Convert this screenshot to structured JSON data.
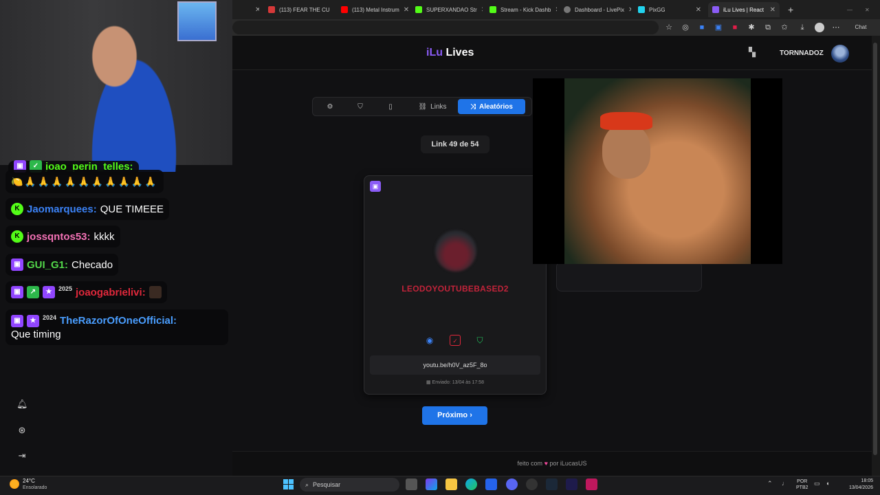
{
  "browser": {
    "tabs": [
      {
        "label": "(113) FEAR THE CU",
        "color": "#d63939"
      },
      {
        "label": "(113) Metal Instrum",
        "color": "#ff0000"
      },
      {
        "label": "SUPERXANDAO Str",
        "color": "#53fc18"
      },
      {
        "label": "Stream - Kick Dashb",
        "color": "#53fc18"
      },
      {
        "label": "Dashboard - LivePix",
        "color": "#777777"
      },
      {
        "label": "PixGG",
        "color": "#22d3ee"
      },
      {
        "label": "iLu Lives | React",
        "color": "#8b5cf6"
      }
    ],
    "new_tab_symbol": "+",
    "close_symbol": "✕",
    "chat_label": "Chat"
  },
  "app": {
    "logo_prefix": "iLu",
    "logo_suffix": "Lives",
    "username": "TORNNADOZ"
  },
  "toolbar": {
    "links_label": "Links",
    "random_label": "Aleatórios"
  },
  "counter": "Link 49 de 54",
  "card": {
    "platform_icon": "twitch-icon",
    "sender": "LEODOYOUTUBEBASED2",
    "url": "youtu.be/h0V_az5F_8o",
    "sent_label": "Enviado: 13/04 às 17:58"
  },
  "next_label": "Próximo ›",
  "footer": {
    "prefix": "feito com",
    "suffix": "por iLucasUS",
    "heart_color": "#ec4899"
  },
  "chat": [
    {
      "user": "joao_perin_telles:",
      "message": "",
      "user_color": "#53fc18"
    },
    {
      "user": "",
      "message": "🍋🙏🙏🙏🙏🙏🙏🙏🙏🙏🙏",
      "user_color": "#ffffff"
    },
    {
      "user": "Jaomarquees:",
      "message": "QUE TIMEEE",
      "user_color": "#3b82f6"
    },
    {
      "user": "jossqntos53:",
      "message": "kkkk",
      "user_color": "#f472b6"
    },
    {
      "user": "GUI_G1:",
      "message": "Checado",
      "user_color": "#53d84a"
    },
    {
      "user": "joaogabrielivi:",
      "message": "",
      "user_color": "#e0283b"
    },
    {
      "user": "TheRazorOfOneOfficial:",
      "message": "Que timing",
      "user_color": "#4a9eff"
    }
  ],
  "badge_year_1": "2025",
  "badge_year_2": "2024",
  "taskbar": {
    "temperature": "24°C",
    "weather": "Ensolarado",
    "search_placeholder": "Pesquisar",
    "lang_1": "POR",
    "lang_2": "PTB2",
    "time": "18:05",
    "date": "13/04/2026"
  }
}
